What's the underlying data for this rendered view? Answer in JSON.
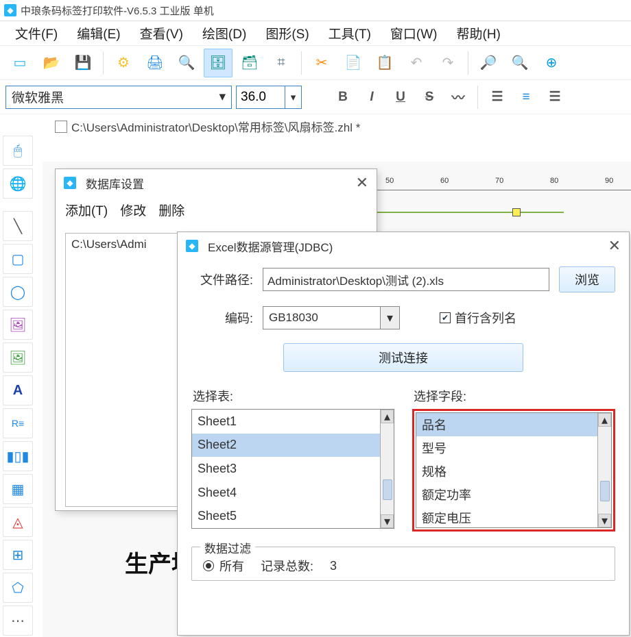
{
  "app": {
    "title": "中琅条码标签打印软件-V6.5.3 工业版 单机"
  },
  "menu": {
    "file": "文件(F)",
    "edit": "编辑(E)",
    "view": "查看(V)",
    "draw": "绘图(D)",
    "shape": "图形(S)",
    "tools": "工具(T)",
    "window": "窗口(W)",
    "help": "帮助(H)"
  },
  "format": {
    "font_name": "微软雅黑",
    "font_size": "36.0"
  },
  "document": {
    "path": "C:\\Users\\Administrator\\Desktop\\常用标签\\风扇标签.zhl *"
  },
  "canvas": {
    "text1": "生产地"
  },
  "dialog_db": {
    "title": "数据库设置",
    "menu_add": "添加(T)",
    "menu_edit": "修改",
    "menu_delete": "删除",
    "list_item1": "C:\\Users\\Admi"
  },
  "dialog_excel": {
    "title": "Excel数据源管理(JDBC)",
    "file_label": "文件路径:",
    "file_value": "Administrator\\Desktop\\测试 (2).xls",
    "browse_btn": "浏览",
    "encoding_label": "编码:",
    "encoding_value": "GB18030",
    "header_checkbox": "首行含列名",
    "test_btn": "测试连接",
    "select_table_label": "选择表:",
    "tables": [
      "Sheet1",
      "Sheet2",
      "Sheet3",
      "Sheet4",
      "Sheet5"
    ],
    "tables_selected_index": 1,
    "select_field_label": "选择字段:",
    "fields": [
      "品名",
      "型号",
      "规格",
      "额定功率",
      "额定电压"
    ],
    "fields_selected_index": 0,
    "filter_legend": "数据过滤",
    "filter_all": "所有",
    "record_count_label": "记录总数:",
    "record_count_value": "3"
  }
}
